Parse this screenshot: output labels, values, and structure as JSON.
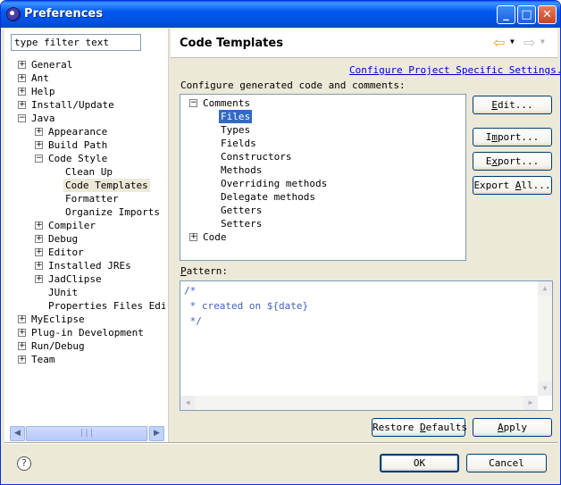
{
  "window": {
    "title": "Preferences"
  },
  "titlebar_buttons": {
    "minimize": "_",
    "maximize": "□",
    "close": "✕"
  },
  "filter": {
    "value": "type filter text"
  },
  "tree": {
    "general": "General",
    "ant": "Ant",
    "help": "Help",
    "install_update": "Install/Update",
    "java": "Java",
    "appearance": "Appearance",
    "build_path": "Build Path",
    "code_style": "Code Style",
    "clean_up": "Clean Up",
    "code_templates": "Code Templates",
    "formatter": "Formatter",
    "organize_imports": "Organize Imports",
    "compiler": "Compiler",
    "debug": "Debug",
    "editor": "Editor",
    "installed_jres": "Installed JREs",
    "jadclipse": "JadClipse",
    "junit": "JUnit",
    "properties_files_editor": "Properties Files Edito",
    "myeclipse": "MyEclipse",
    "plugin_development": "Plug-in Development",
    "run_debug": "Run/Debug",
    "team": "Team"
  },
  "page": {
    "title": "Code Templates",
    "configure_link": "Configure Project Specific Settings...",
    "description": "Configure generated code and comments:"
  },
  "templates": {
    "comments": "Comments",
    "files": "Files",
    "types": "Types",
    "fields": "Fields",
    "constructors": "Constructors",
    "methods": "Methods",
    "overriding_methods": "Overriding methods",
    "delegate_methods": "Delegate methods",
    "getters": "Getters",
    "setters": "Setters",
    "code": "Code"
  },
  "side_buttons": {
    "edit": {
      "key": "E",
      "rest": "dit..."
    },
    "import": {
      "pre": "I",
      "key": "m",
      "rest": "port..."
    },
    "export": {
      "pre": "E",
      "key": "x",
      "rest": "port..."
    },
    "export_all": {
      "pre": "Export ",
      "key": "A",
      "rest": "ll..."
    }
  },
  "pattern": {
    "label_key": "P",
    "label_rest": "attern:",
    "lines": [
      "/*",
      " * created on ${date}",
      " */"
    ]
  },
  "bottom_buttons": {
    "restore_defaults": {
      "pre": "Restore ",
      "key": "D",
      "rest": "efaults"
    },
    "apply": {
      "key": "A",
      "rest": "pply"
    },
    "ok": "OK",
    "cancel": "Cancel"
  },
  "help": {
    "glyph": "?"
  },
  "colors": {
    "title_bar": "#0054e3",
    "selection": "#316ac5",
    "link": "#0000cc",
    "comment": "#3f5fbf",
    "dialog_bg": "#ece9d8"
  }
}
